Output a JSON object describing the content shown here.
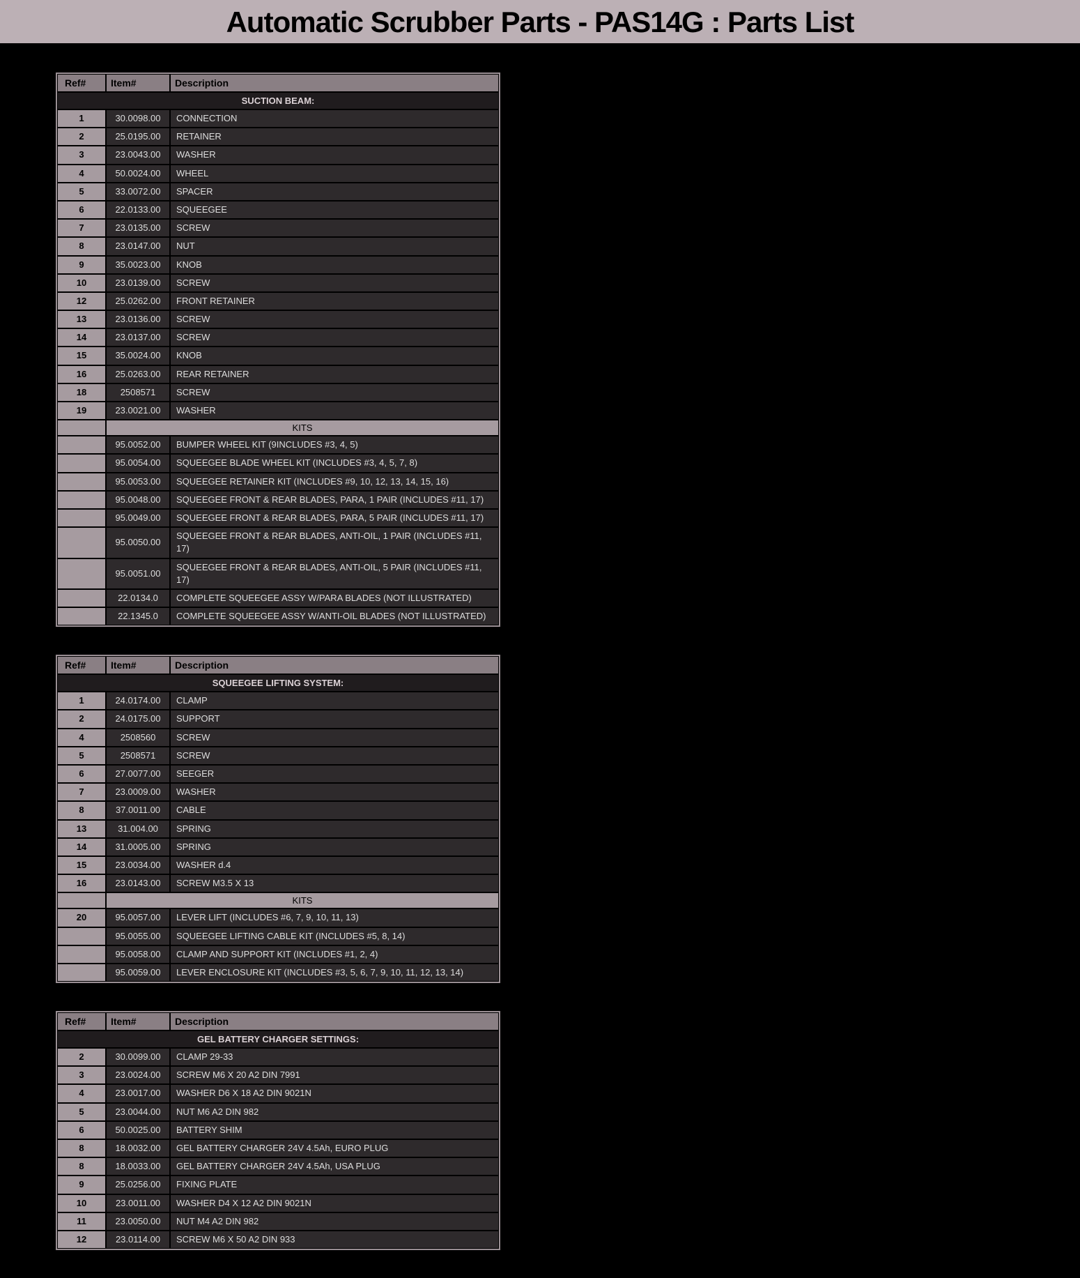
{
  "page_title": "Automatic Scrubber Parts - PAS14G : Parts List",
  "columns": {
    "ref": "Ref#",
    "item": "Item#",
    "desc": "Description"
  },
  "kits_label": "KITS",
  "sections": [
    {
      "title": "SUCTION BEAM:",
      "rows": [
        {
          "ref": "1",
          "item": "30.0098.00",
          "desc": "CONNECTION"
        },
        {
          "ref": "2",
          "item": "25.0195.00",
          "desc": "RETAINER"
        },
        {
          "ref": "3",
          "item": "23.0043.00",
          "desc": "WASHER"
        },
        {
          "ref": "4",
          "item": "50.0024.00",
          "desc": "WHEEL"
        },
        {
          "ref": "5",
          "item": "33.0072.00",
          "desc": "SPACER"
        },
        {
          "ref": "6",
          "item": "22.0133.00",
          "desc": "SQUEEGEE"
        },
        {
          "ref": "7",
          "item": "23.0135.00",
          "desc": "SCREW"
        },
        {
          "ref": "8",
          "item": "23.0147.00",
          "desc": "NUT"
        },
        {
          "ref": "9",
          "item": "35.0023.00",
          "desc": "KNOB"
        },
        {
          "ref": "10",
          "item": "23.0139.00",
          "desc": "SCREW"
        },
        {
          "ref": "12",
          "item": "25.0262.00",
          "desc": "FRONT RETAINER"
        },
        {
          "ref": "13",
          "item": "23.0136.00",
          "desc": "SCREW"
        },
        {
          "ref": "14",
          "item": "23.0137.00",
          "desc": "SCREW"
        },
        {
          "ref": "15",
          "item": "35.0024.00",
          "desc": "KNOB"
        },
        {
          "ref": "16",
          "item": "25.0263.00",
          "desc": "REAR RETAINER"
        },
        {
          "ref": "18",
          "item": "2508571",
          "desc": "SCREW"
        },
        {
          "ref": "19",
          "item": "23.0021.00",
          "desc": "WASHER"
        }
      ],
      "kits": [
        {
          "ref": "",
          "item": "95.0052.00",
          "desc": "BUMPER WHEEL KIT (9INCLUDES #3, 4, 5)"
        },
        {
          "ref": "",
          "item": "95.0054.00",
          "desc": "SQUEEGEE BLADE WHEEL KIT (INCLUDES #3, 4, 5, 7, 8)"
        },
        {
          "ref": "",
          "item": "95.0053.00",
          "desc": "SQUEEGEE RETAINER KIT (INCLUDES #9, 10, 12, 13, 14, 15, 16)"
        },
        {
          "ref": "",
          "item": "95.0048.00",
          "desc": "SQUEEGEE FRONT & REAR BLADES, PARA, 1 PAIR (INCLUDES #11, 17)"
        },
        {
          "ref": "",
          "item": "95.0049.00",
          "desc": "SQUEEGEE FRONT & REAR BLADES, PARA, 5 PAIR (INCLUDES #11, 17)"
        },
        {
          "ref": "",
          "item": "95.0050.00",
          "desc": "SQUEEGEE FRONT & REAR BLADES, ANTI-OIL, 1 PAIR (INCLUDES #11, 17)"
        },
        {
          "ref": "",
          "item": "95.0051.00",
          "desc": "SQUEEGEE FRONT & REAR BLADES, ANTI-OIL, 5 PAIR (INCLUDES #11, 17)"
        },
        {
          "ref": "",
          "item": "22.0134.0",
          "desc": "COMPLETE SQUEEGEE ASSY W/PARA BLADES (NOT ILLUSTRATED)"
        },
        {
          "ref": "",
          "item": "22.1345.0",
          "desc": "COMPLETE SQUEEGEE ASSY W/ANTI-OIL BLADES (NOT ILLUSTRATED)"
        }
      ]
    },
    {
      "title": "SQUEEGEE LIFTING SYSTEM:",
      "rows": [
        {
          "ref": "1",
          "item": "24.0174.00",
          "desc": "CLAMP"
        },
        {
          "ref": "2",
          "item": "24.0175.00",
          "desc": "SUPPORT"
        },
        {
          "ref": "4",
          "item": "2508560",
          "desc": "SCREW"
        },
        {
          "ref": "5",
          "item": "2508571",
          "desc": "SCREW"
        },
        {
          "ref": "6",
          "item": "27.0077.00",
          "desc": "SEEGER"
        },
        {
          "ref": "7",
          "item": "23.0009.00",
          "desc": "WASHER"
        },
        {
          "ref": "8",
          "item": "37.0011.00",
          "desc": "CABLE"
        },
        {
          "ref": "13",
          "item": "31.004.00",
          "desc": "SPRING"
        },
        {
          "ref": "14",
          "item": "31.0005.00",
          "desc": "SPRING"
        },
        {
          "ref": "15",
          "item": "23.0034.00",
          "desc": "WASHER d.4"
        },
        {
          "ref": "16",
          "item": "23.0143.00",
          "desc": "SCREW M3.5 X 13"
        }
      ],
      "kits": [
        {
          "ref": "20",
          "item": "95.0057.00",
          "desc": "LEVER LIFT (INCLUDES #6, 7, 9, 10, 11, 13)"
        },
        {
          "ref": "",
          "item": "95.0055.00",
          "desc": "SQUEEGEE LIFTING CABLE KIT (INCLUDES #5, 8, 14)"
        },
        {
          "ref": "",
          "item": "95.0058.00",
          "desc": "CLAMP AND SUPPORT KIT (INCLUDES #1, 2, 4)"
        },
        {
          "ref": "",
          "item": "95.0059.00",
          "desc": "LEVER ENCLOSURE KIT (INCLUDES #3, 5, 6, 7, 9, 10, 11, 12, 13, 14)"
        }
      ]
    },
    {
      "title": "GEL BATTERY CHARGER SETTINGS:",
      "rows": [
        {
          "ref": "2",
          "item": "30.0099.00",
          "desc": "CLAMP 29-33"
        },
        {
          "ref": "3",
          "item": "23.0024.00",
          "desc": "SCREW M6 X 20 A2 DIN 7991"
        },
        {
          "ref": "4",
          "item": "23.0017.00",
          "desc": "WASHER D6 X 18 A2 DIN 9021N"
        },
        {
          "ref": "5",
          "item": "23.0044.00",
          "desc": "NUT M6 A2 DIN 982"
        },
        {
          "ref": "6",
          "item": "50.0025.00",
          "desc": "BATTERY SHIM"
        },
        {
          "ref": "8",
          "item": "18.0032.00",
          "desc": "GEL BATTERY CHARGER 24V 4.5Ah, EURO PLUG"
        },
        {
          "ref": "8",
          "item": "18.0033.00",
          "desc": "GEL BATTERY CHARGER 24V 4.5Ah, USA PLUG"
        },
        {
          "ref": "9",
          "item": "25.0256.00",
          "desc": "FIXING PLATE"
        },
        {
          "ref": "10",
          "item": "23.0011.00",
          "desc": "WASHER D4 X 12 A2 DIN 9021N"
        },
        {
          "ref": "11",
          "item": "23.0050.00",
          "desc": "NUT M4 A2 DIN 982"
        },
        {
          "ref": "12",
          "item": "23.0114.00",
          "desc": "SCREW M6 X 50 A2 DIN 933"
        }
      ],
      "kits": []
    }
  ]
}
